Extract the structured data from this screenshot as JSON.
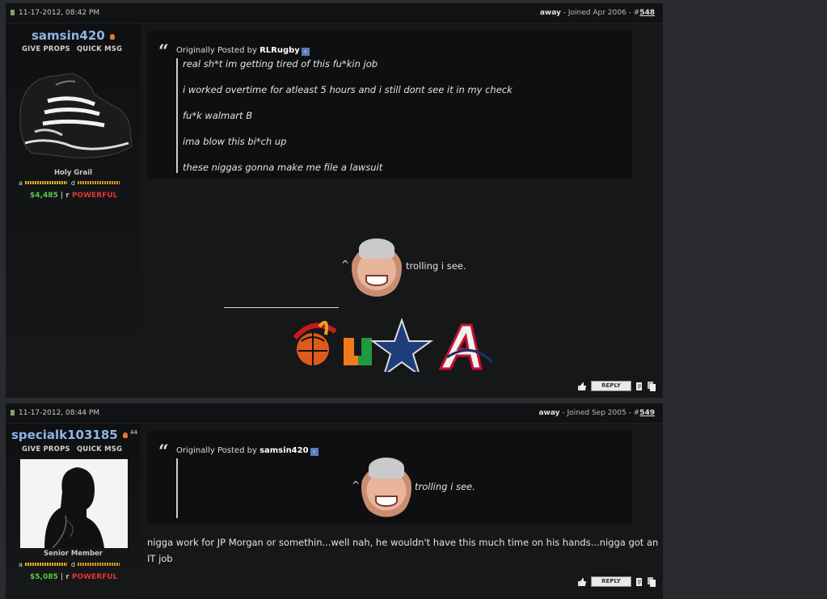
{
  "posts": [
    {
      "date": "11-17-2012, 08:42 PM",
      "status": "away",
      "joined": " - Joined Apr 2006 - #",
      "post_number": "548",
      "username": "samsin420",
      "links": {
        "props": "GIVE PROPS",
        "msg": "QUICK MSG"
      },
      "rank": "Holy Grail",
      "bar_a": "a",
      "bar_d": "d",
      "money": "$4,485",
      "sep": " | ",
      "r": "r ",
      "power": "POWERFUL",
      "quote": {
        "prefix": "Originally Posted by ",
        "author": "RLRugby",
        "lines": [
          "real sh*t im getting tired of this fu*kin job",
          "i worked overtime for atleast 5 hours and i still dont see it in my check",
          "fu*k walmart B",
          "ima blow this bi*ch up",
          "these niggas gonna make me file a lawsuit"
        ]
      },
      "caret": "^",
      "reply_text": "trolling i see.",
      "icons": {
        "thumb": "thumbs-up-icon",
        "reply": "REPLY",
        "quote": "quote-icon",
        "multi": "multiquote-icon"
      }
    },
    {
      "date": "11-17-2012, 08:44 PM",
      "status": "away",
      "joined": " - Joined Sep 2005 - #",
      "post_number": "549",
      "username": "specialk103185",
      "rep_count": "44",
      "links": {
        "props": "GIVE PROPS",
        "msg": "QUICK MSG"
      },
      "rank": "Senior Member",
      "bar_a": "a",
      "bar_d": "d",
      "money": "$5,085",
      "sep": " | ",
      "r": "r ",
      "power": "POWERFUL",
      "quote": {
        "prefix": "Originally Posted by ",
        "author": "samsin420",
        "caret": "^",
        "text": "trolling i see."
      },
      "body": "nigga work for JP Morgan or somethin...well nah, he wouldn't have this much time on his hands...nigga got an IT job",
      "icons": {
        "thumb": "thumbs-up-icon",
        "reply": "REPLY",
        "quote": "quote-icon",
        "multi": "multiquote-icon"
      }
    }
  ],
  "colors": {
    "page_bg": "#2a2b2f",
    "post_bg": "#161719",
    "username": "#8fb4e8",
    "money": "#58c94a",
    "powerful": "#e23434"
  }
}
